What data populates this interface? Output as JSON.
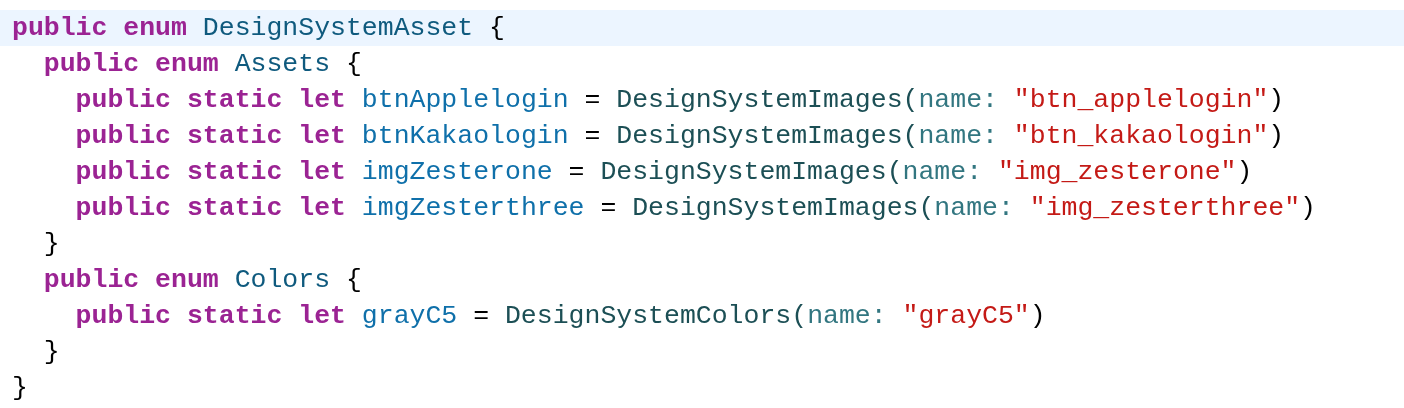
{
  "code_lines": [
    {
      "highlighted": true,
      "tokens": [
        {
          "kind": "keyword",
          "text": "public enum"
        },
        {
          "kind": "type",
          "text": "DesignSystemAsset"
        },
        {
          "kind": "plain",
          "text": "{"
        }
      ],
      "children": [
        {
          "highlighted": false,
          "tokens": [
            {
              "kind": "keyword",
              "text": "public enum"
            },
            {
              "kind": "type",
              "text": "Assets"
            },
            {
              "kind": "plain",
              "text": "{"
            }
          ],
          "children": [
            {
              "highlighted": false,
              "tokens": [
                {
                  "kind": "keyword",
                  "text": "public static let"
                },
                {
                  "kind": "decl",
                  "text": "btnApplelogin"
                },
                {
                  "kind": "plain",
                  "text": "="
                },
                {
                  "kind": "call",
                  "text": "DesignSystemImages("
                },
                {
                  "kind": "param",
                  "text": "name:"
                },
                {
                  "kind": "string",
                  "text": "\"btn_applelogin\""
                },
                {
                  "kind": "plain",
                  "text": ")"
                }
              ]
            },
            {
              "highlighted": false,
              "tokens": [
                {
                  "kind": "keyword",
                  "text": "public static let"
                },
                {
                  "kind": "decl",
                  "text": "btnKakaologin"
                },
                {
                  "kind": "plain",
                  "text": "="
                },
                {
                  "kind": "call",
                  "text": "DesignSystemImages("
                },
                {
                  "kind": "param",
                  "text": "name:"
                },
                {
                  "kind": "string",
                  "text": "\"btn_kakaologin\""
                },
                {
                  "kind": "plain",
                  "text": ")"
                }
              ]
            },
            {
              "highlighted": false,
              "tokens": [
                {
                  "kind": "keyword",
                  "text": "public static let"
                },
                {
                  "kind": "decl",
                  "text": "imgZesterone"
                },
                {
                  "kind": "plain",
                  "text": "="
                },
                {
                  "kind": "call",
                  "text": "DesignSystemImages("
                },
                {
                  "kind": "param",
                  "text": "name:"
                },
                {
                  "kind": "string",
                  "text": "\"img_zesterone\""
                },
                {
                  "kind": "plain",
                  "text": ")"
                }
              ]
            },
            {
              "highlighted": false,
              "tokens": [
                {
                  "kind": "keyword",
                  "text": "public static let"
                },
                {
                  "kind": "decl",
                  "text": "imgZesterthree"
                },
                {
                  "kind": "plain",
                  "text": "="
                },
                {
                  "kind": "call",
                  "text": "DesignSystemImages("
                },
                {
                  "kind": "param",
                  "text": "name:"
                },
                {
                  "kind": "string",
                  "text": "\"img_zesterthree\""
                },
                {
                  "kind": "plain",
                  "text": ")"
                }
              ]
            }
          ],
          "closing": "}"
        },
        {
          "highlighted": false,
          "tokens": [
            {
              "kind": "keyword",
              "text": "public enum"
            },
            {
              "kind": "type",
              "text": "Colors"
            },
            {
              "kind": "plain",
              "text": "{"
            }
          ],
          "children": [
            {
              "highlighted": false,
              "tokens": [
                {
                  "kind": "keyword",
                  "text": "public static let"
                },
                {
                  "kind": "decl",
                  "text": "grayC5"
                },
                {
                  "kind": "plain",
                  "text": "="
                },
                {
                  "kind": "call",
                  "text": "DesignSystemColors("
                },
                {
                  "kind": "param",
                  "text": "name:"
                },
                {
                  "kind": "string",
                  "text": "\"grayC5\""
                },
                {
                  "kind": "plain",
                  "text": ")"
                }
              ]
            }
          ],
          "closing": "}"
        }
      ],
      "closing": "}"
    }
  ]
}
